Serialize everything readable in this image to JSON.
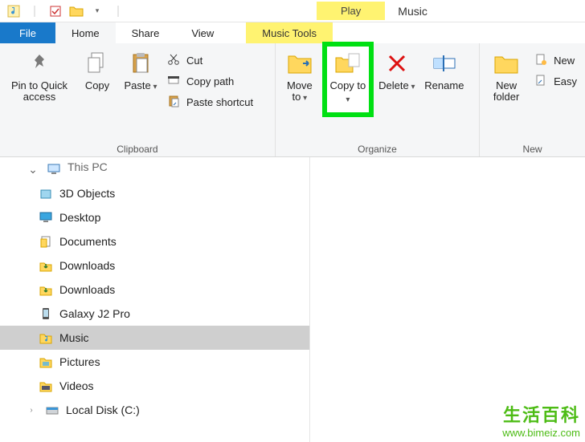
{
  "window": {
    "title": "Music"
  },
  "context_tab": {
    "heading": "Play",
    "tools": "Music Tools"
  },
  "tabs": {
    "file": "File",
    "home": "Home",
    "share": "Share",
    "view": "View"
  },
  "ribbon": {
    "clipboard": {
      "label": "Clipboard",
      "pin": "Pin to Quick access",
      "copy": "Copy",
      "paste": "Paste",
      "cut": "Cut",
      "copy_path": "Copy path",
      "paste_shortcut": "Paste shortcut"
    },
    "organize": {
      "label": "Organize",
      "move_to": "Move to",
      "copy_to": "Copy to",
      "delete": "Delete",
      "rename": "Rename"
    },
    "new": {
      "label": "New",
      "new_folder": "New folder",
      "new_item": "New",
      "easy_access": "Easy"
    }
  },
  "tree": {
    "this_pc": "This PC",
    "items": [
      {
        "label": "3D Objects"
      },
      {
        "label": "Desktop"
      },
      {
        "label": "Documents"
      },
      {
        "label": "Downloads"
      },
      {
        "label": "Downloads"
      },
      {
        "label": "Galaxy J2 Pro"
      },
      {
        "label": "Music"
      },
      {
        "label": "Pictures"
      },
      {
        "label": "Videos"
      },
      {
        "label": "Local Disk (C:)"
      }
    ]
  },
  "watermark": {
    "cn": "生活百科",
    "url": "www.bimeiz.com"
  }
}
